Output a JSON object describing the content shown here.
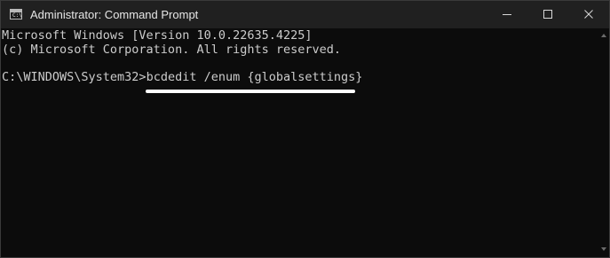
{
  "window": {
    "title": "Administrator: Command Prompt",
    "icon": "cmd-icon",
    "icon_prompt": "C:\\"
  },
  "controls": {
    "minimize": "minimize-icon",
    "maximize": "maximize-icon",
    "close": "close-icon"
  },
  "console": {
    "lines": [
      "Microsoft Windows [Version 10.0.22635.4225]",
      "(c) Microsoft Corporation. All rights reserved.",
      ""
    ],
    "prompt": "C:\\WINDOWS\\System32>",
    "command": "bcdedit /enum {globalsettings}"
  },
  "colors": {
    "background": "#0c0c0c",
    "titlebar": "#202020",
    "text": "#cccccc",
    "highlight": "#ffffff"
  }
}
